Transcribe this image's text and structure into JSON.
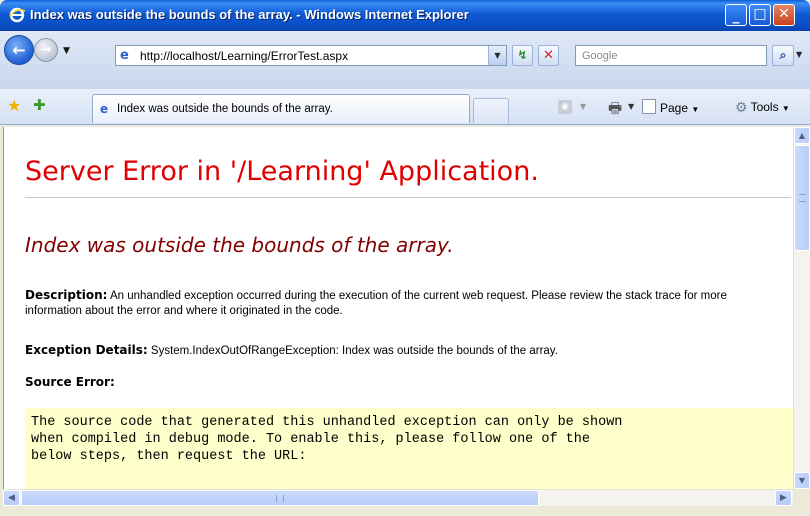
{
  "window": {
    "title": "Index was outside the bounds of the array. - Windows Internet Explorer",
    "min_glyph": "_",
    "max_glyph": "□",
    "close_glyph": "✕"
  },
  "nav": {
    "back_glyph": "←",
    "forward_glyph": "→",
    "dropdown_glyph": "▼",
    "address_url": "http://localhost/Learning/ErrorTest.aspx",
    "refresh_glyph": "↯",
    "stop_glyph": "✕",
    "search_placeholder": "Google",
    "search_glyph": "⌕"
  },
  "tabs": {
    "active_tab_title": "Index was outside the bounds of the array."
  },
  "command_bar": {
    "page_label": "Page",
    "tools_label": "Tools",
    "dropdown_glyph": "▼"
  },
  "content": {
    "heading": "Server Error in '/Learning' Application.",
    "error_title": "Index was outside the bounds of the array.",
    "description_label": "Description:",
    "description_text": " An unhandled exception occurred during the execution of the current web request. Please review the stack trace for more information about the error and where it originated in the code.",
    "exception_label": "Exception Details:",
    "exception_text": " System.IndexOutOfRangeException: Index was outside the bounds of the array.",
    "source_error_label": "Source Error:",
    "source_code_text": "The source code that generated this unhandled exception can only be shown\nwhen compiled in debug mode. To enable this, please follow one of the\nbelow steps, then request the URL:"
  },
  "colors": {
    "heading": "#e00000",
    "error_title": "#800000",
    "code_background": "#ffffcc",
    "titlebar": "#0a4fc4"
  }
}
